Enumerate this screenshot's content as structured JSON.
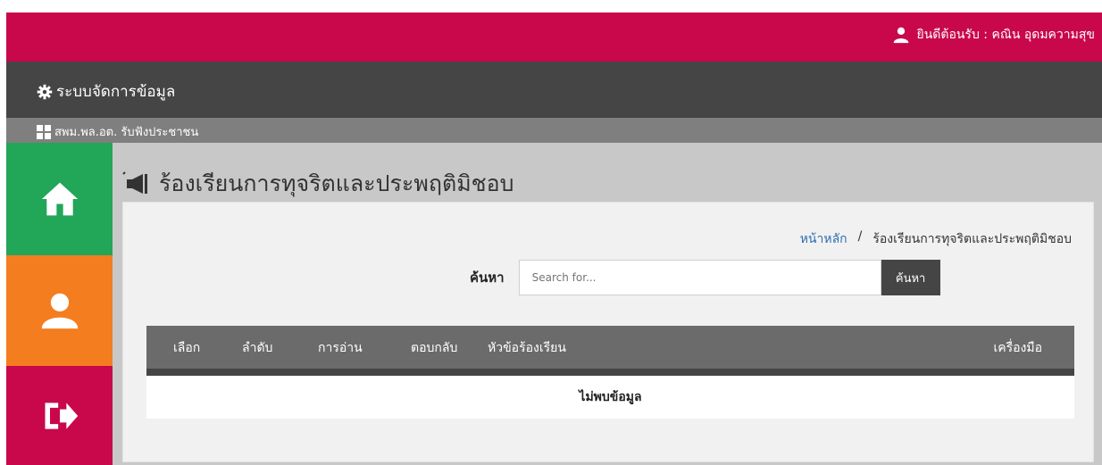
{
  "header": {
    "welcome_text": "ยินดีต้อนรับ : คณิน อุดมความสุข",
    "user_icon": "user-icon"
  },
  "system_bar": {
    "title": "ระบบจัดการข้อมูล",
    "icon": "gear-icon"
  },
  "sub_bar": {
    "label": "สพม.พล.อต. รับฟังประชาชน",
    "icon": "grid-icon"
  },
  "sidebar": {
    "items": [
      {
        "name": "home",
        "icon": "home-icon",
        "color": "#22a657"
      },
      {
        "name": "profile",
        "icon": "user-icon",
        "color": "#f47d20"
      },
      {
        "name": "logout",
        "icon": "logout-icon",
        "color": "#c8084a"
      }
    ]
  },
  "page": {
    "title": "ร้องเรียนการทุจริตและประพฤติมิชอบ",
    "title_icon": "megaphone-icon"
  },
  "breadcrumb": {
    "home": "หน้าหลัก",
    "separator": "/",
    "current": "ร้องเรียนการทุจริตและประพฤติมิชอบ"
  },
  "search": {
    "label": "ค้นหา",
    "placeholder": "Search for...",
    "value": "",
    "button": "ค้นหา"
  },
  "table": {
    "columns": [
      "เลือก",
      "ลำดับ",
      "การอ่าน",
      "ตอบกลับ",
      "หัวข้อร้องเรียน",
      "เครื่องมือ"
    ],
    "empty_message": "ไม่พบข้อมูล"
  },
  "colors": {
    "brand": "#c8084a",
    "dark": "#454545",
    "green": "#22a657",
    "orange": "#f47d20",
    "link": "#2f6fb0"
  }
}
